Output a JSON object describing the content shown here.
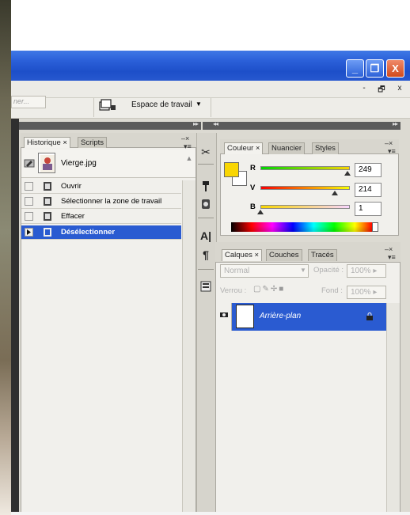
{
  "window": {
    "controls": {
      "minimize": "_",
      "maximize": "❐",
      "close": "X"
    },
    "inner_controls": [
      "-",
      "🗗",
      "x"
    ]
  },
  "options_bar": {
    "search_placeholder": "ner...",
    "workspace_label": "Espace de travail",
    "workspace_arrow": "▼"
  },
  "history_panel": {
    "tabs": [
      {
        "label": "Historique",
        "close": "×",
        "active": true
      },
      {
        "label": "Scripts",
        "active": false
      }
    ],
    "snapshot_name": "Vierge.jpg",
    "steps": [
      {
        "label": "Ouvrir",
        "selected": false
      },
      {
        "label": "Sélectionner la zone de travail",
        "selected": false
      },
      {
        "label": "Effacer",
        "selected": false
      },
      {
        "label": "Désélectionner",
        "selected": true
      }
    ]
  },
  "color_panel": {
    "tabs": [
      {
        "label": "Couleur",
        "close": "×",
        "active": true
      },
      {
        "label": "Nuancier",
        "active": false
      },
      {
        "label": "Styles",
        "active": false
      }
    ],
    "foreground": "#f9d602",
    "background": "#ffffff",
    "channels": [
      {
        "label": "R",
        "value": "249"
      },
      {
        "label": "V",
        "value": "214"
      },
      {
        "label": "B",
        "value": "1"
      }
    ]
  },
  "layers_panel": {
    "tabs": [
      {
        "label": "Calques",
        "close": "×",
        "active": true
      },
      {
        "label": "Couches",
        "active": false
      },
      {
        "label": "Tracés",
        "active": false
      }
    ],
    "blend_mode": "Normal",
    "opacity_label": "Opacité :",
    "opacity_value": "100%",
    "lock_label": "Verrou :",
    "fill_label": "Fond :",
    "fill_value": "100%",
    "layers": [
      {
        "name": "Arrière-plan",
        "visible": true,
        "locked": true
      }
    ]
  },
  "colors": {
    "titlebar": "#2a5fd8",
    "selection": "#2a5bd1",
    "panel_bg": "#f1f0ec"
  }
}
